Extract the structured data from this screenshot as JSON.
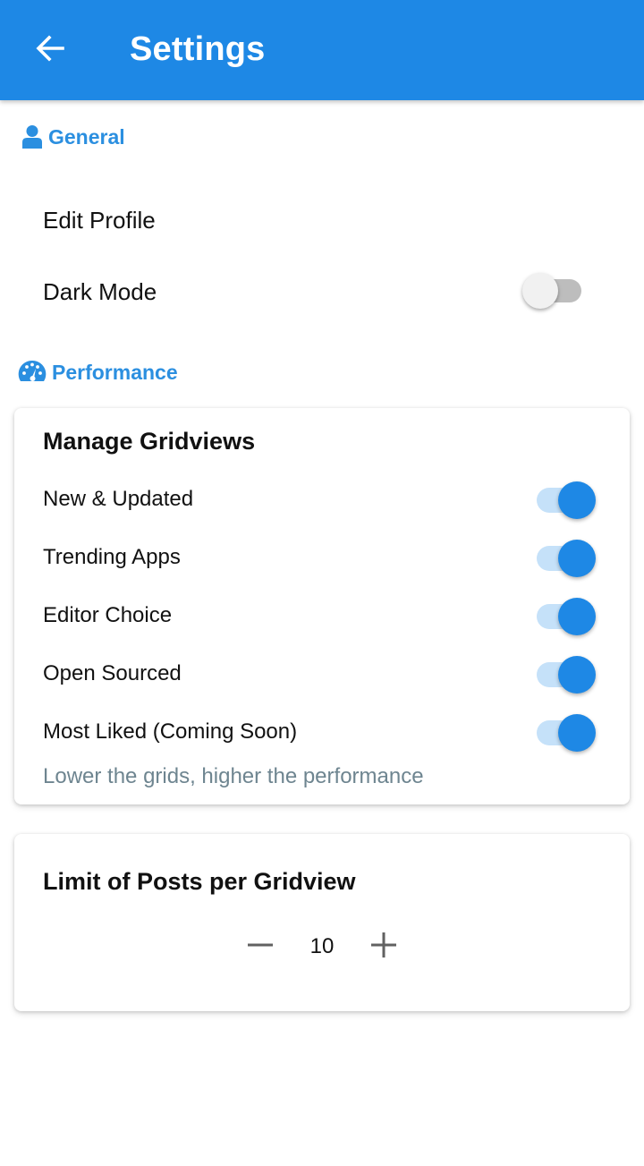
{
  "appbar": {
    "title": "Settings"
  },
  "general": {
    "header": "General",
    "icon": "person-icon",
    "edit_profile": "Edit Profile",
    "dark_mode": {
      "label": "Dark Mode",
      "enabled": false
    }
  },
  "performance": {
    "header": "Performance",
    "icon": "speedometer-icon",
    "gridviews_card": {
      "title": "Manage Gridviews",
      "items": [
        {
          "label": "New & Updated",
          "enabled": true
        },
        {
          "label": "Trending Apps",
          "enabled": true
        },
        {
          "label": "Editor Choice",
          "enabled": true
        },
        {
          "label": "Open Sourced",
          "enabled": true
        },
        {
          "label": "Most Liked (Coming Soon)",
          "enabled": true
        }
      ],
      "hint": "Lower the grids, higher the performance"
    },
    "limit_card": {
      "title": "Limit of Posts per Gridview",
      "value": "10"
    }
  },
  "colors": {
    "primary": "#1e88e5",
    "section_header": "#2b8fe0",
    "switch_on_track": "#c5e1f9",
    "switch_off_track": "#bdbdbd",
    "hint_text": "#6e8590"
  }
}
